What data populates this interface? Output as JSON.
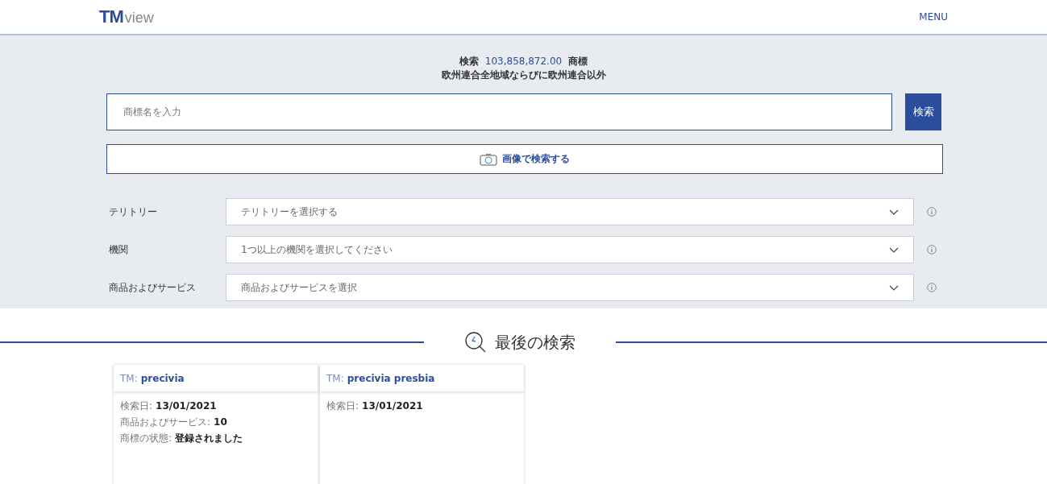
{
  "header": {
    "logo_mark": "TM",
    "logo_word": "view",
    "menu": "MENU"
  },
  "summary": {
    "prefix": "検索",
    "count": "103,858,872.00",
    "suffix": "商標",
    "scope": "欧州連合全地域ならびに欧州連合以外"
  },
  "search": {
    "placeholder": "商標名を入力",
    "button": "検索",
    "image_search": "画像で検索する"
  },
  "filters": [
    {
      "label": "テリトリー",
      "placeholder": "テリトリーを選択する"
    },
    {
      "label": "機関",
      "placeholder": "1つ以上の機関を選択してください"
    },
    {
      "label": "商品およびサービス",
      "placeholder": "商品およびサービスを選択"
    }
  ],
  "recent": {
    "title": "最後の検索",
    "cards": [
      {
        "prefix": "TM:",
        "name": "precivia",
        "details": [
          {
            "label": "検索日:",
            "value": "13/01/2021"
          },
          {
            "label": "商品およびサービス:",
            "value": "10"
          },
          {
            "label": "商標の状態:",
            "value": "登録されました"
          }
        ]
      },
      {
        "prefix": "TM:",
        "name": "precivia presbia",
        "details": [
          {
            "label": "検索日:",
            "value": "13/01/2021"
          }
        ]
      }
    ]
  }
}
